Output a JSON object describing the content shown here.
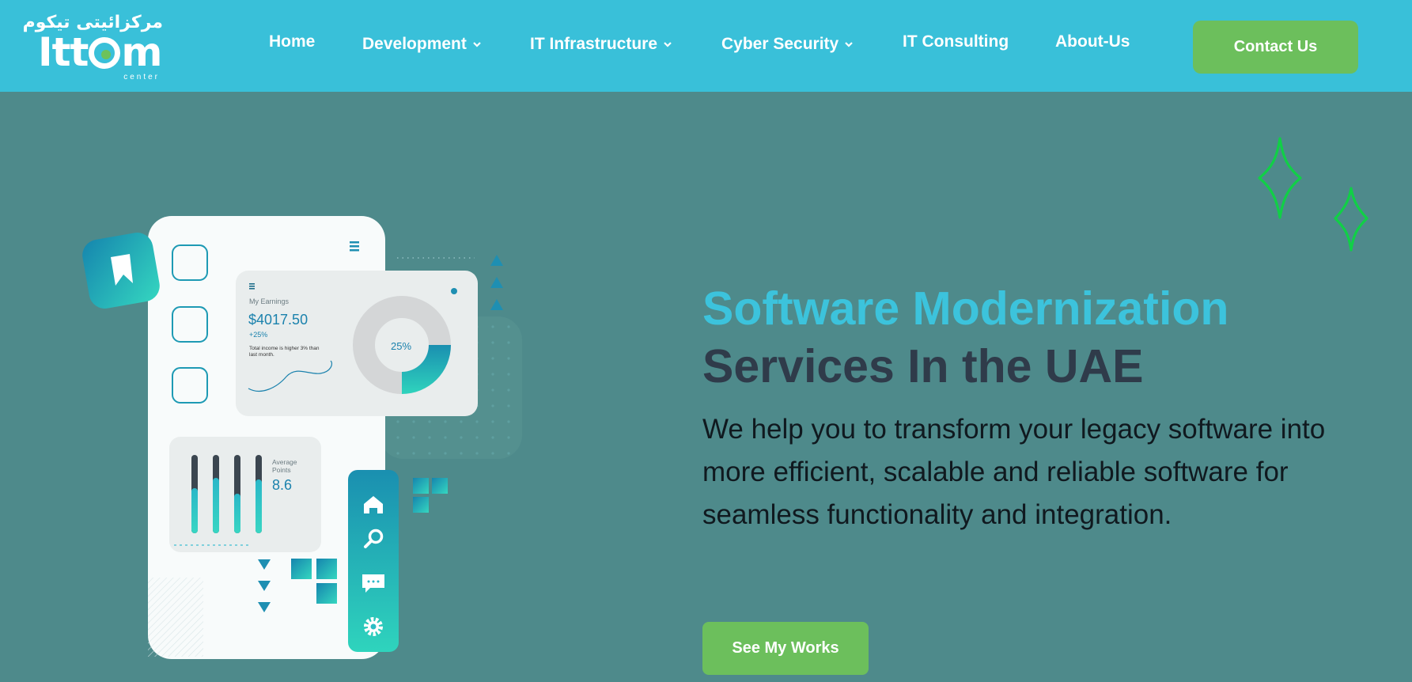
{
  "brand": {
    "arabic": "مركزائيتى تيكوم",
    "latin_prefix": "Itt",
    "latin_suffix": "m",
    "sub": "center"
  },
  "nav": {
    "items": [
      {
        "label": "Home",
        "has_dropdown": false
      },
      {
        "label": "Development",
        "has_dropdown": true
      },
      {
        "label": "IT Infrastructure",
        "has_dropdown": true
      },
      {
        "label": "Cyber Security",
        "has_dropdown": true
      },
      {
        "label": "IT Consulting",
        "has_dropdown": false
      },
      {
        "label": "About-Us",
        "has_dropdown": false
      }
    ],
    "contact_label": "Contact Us"
  },
  "hero": {
    "title_line1": "Software Modernization",
    "title_line2": "Services In the UAE",
    "description": "We help you to transform your legacy software into more efficient, scalable and reliable software for seamless functionality and integration.",
    "cta_label": "See My Works"
  },
  "illustration": {
    "earnings_label": "My Earnings",
    "earnings_value": "$4017.50",
    "earnings_change": "+25%",
    "earnings_note_line1": "Total income is higher 3% than",
    "earnings_note_line2": "last month.",
    "donut_label": "25%",
    "donut_fraction": 0.25,
    "avg_label_line1": "Average",
    "avg_label_line2": "Points",
    "avg_value": "8.6"
  },
  "colors": {
    "header_bg": "#39c0d9",
    "page_bg": "#4e8a8b",
    "accent_green": "#6cbf5c",
    "title_cyan": "#3cc3dc",
    "title_dark": "#2f3b4a",
    "sparkle_green": "#10d046"
  },
  "icons": [
    "bookmark-icon",
    "menu-icon",
    "home-icon",
    "search-icon",
    "chat-icon",
    "gear-icon",
    "chevron-down-icon",
    "sparkle-icon"
  ]
}
